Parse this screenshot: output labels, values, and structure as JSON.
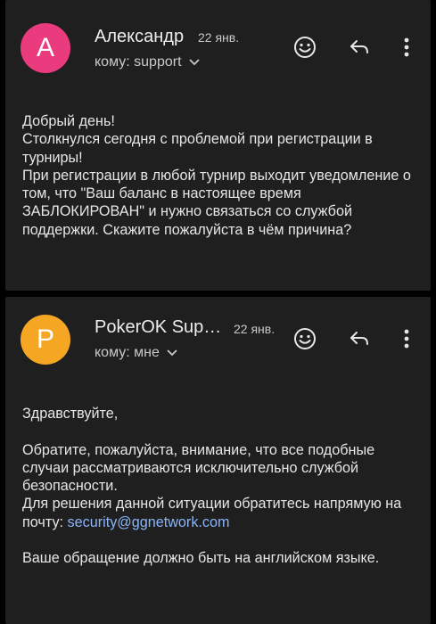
{
  "messages": [
    {
      "avatar_letter": "А",
      "avatar_color": "#e93b7d",
      "sender": "Александр",
      "date": "22 янв.",
      "recipients": "кому: support",
      "body": "Добрый день!\nСтолкнулся сегодня с проблемой при регистрации в турниры!\nПри регистрации в любой турнир выходит уведомление о том, что \"Ваш баланс в настоящее время ЗАБЛОКИРОВАН\" и нужно связаться со службой поддержки. Скажите пожалуйста в чём причина?"
    },
    {
      "avatar_letter": "P",
      "avatar_color": "#f5a623",
      "sender": "PokerOK Sup…",
      "date": "22 янв.",
      "recipients": "кому: мне",
      "body_before_link": "Здравствуйте,\n\nОбратите, пожалуйста, внимание, что все подобные случаи рассматриваются исключительно службой безопасности.\nДля решения данной ситуации обратитесь напрямую на почту: ",
      "link": "security@ggnetwork.com",
      "body_after_link": "\n\nВаше обращение должно быть на английском языке."
    }
  ],
  "icons": {
    "emoji": "emoji-reaction-icon",
    "reply": "reply-icon",
    "more": "more-vert-icon",
    "expand": "chevron-down-icon"
  }
}
